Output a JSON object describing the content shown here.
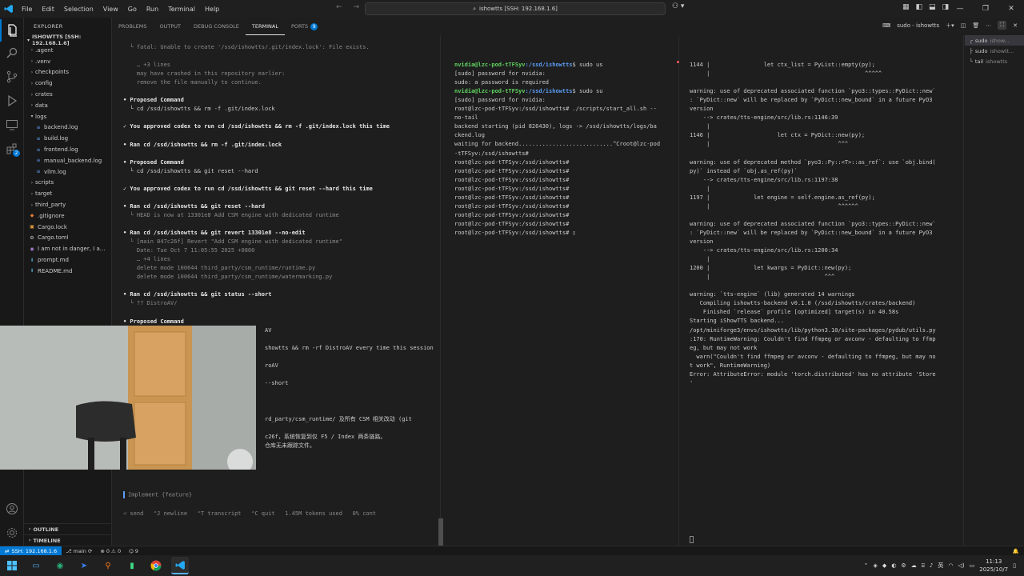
{
  "titlebar": {
    "menu": [
      "File",
      "Edit",
      "Selection",
      "View",
      "Go",
      "Run",
      "Terminal",
      "Help"
    ],
    "command_center": "ishowtts [SSH: 192.168.1.6]"
  },
  "sidebar": {
    "header": "EXPLORER",
    "root": "ISHOWTTS [SSH: 192.168.1.6]",
    "items": [
      {
        "label": ".agent",
        "type": "folder",
        "depth": 1,
        "expanded": false
      },
      {
        "label": ".venv",
        "type": "folder",
        "depth": 1,
        "expanded": false
      },
      {
        "label": "checkpoints",
        "type": "folder",
        "depth": 1,
        "expanded": false
      },
      {
        "label": "config",
        "type": "folder",
        "depth": 1,
        "expanded": false
      },
      {
        "label": "crates",
        "type": "folder",
        "depth": 1,
        "expanded": false
      },
      {
        "label": "data",
        "type": "folder",
        "depth": 1,
        "expanded": false
      },
      {
        "label": "logs",
        "type": "folder",
        "depth": 1,
        "expanded": true
      },
      {
        "label": "backend.log",
        "type": "log",
        "depth": 2
      },
      {
        "label": "build.log",
        "type": "log",
        "depth": 2
      },
      {
        "label": "frontend.log",
        "type": "log",
        "depth": 2
      },
      {
        "label": "manual_backend.log",
        "type": "log",
        "depth": 2
      },
      {
        "label": "vllm.log",
        "type": "log",
        "depth": 2
      },
      {
        "label": "scripts",
        "type": "folder",
        "depth": 1,
        "expanded": false
      },
      {
        "label": "target",
        "type": "folder",
        "depth": 1,
        "expanded": false
      },
      {
        "label": "third_party",
        "type": "folder",
        "depth": 1,
        "expanded": false
      },
      {
        "label": ".gitignore",
        "type": "git",
        "depth": 1
      },
      {
        "label": "Cargo.lock",
        "type": "lock",
        "depth": 1
      },
      {
        "label": "Cargo.toml",
        "type": "toml",
        "depth": 1
      },
      {
        "label": "I am not in danger, I a...",
        "type": "audio",
        "depth": 1
      },
      {
        "label": "prompt.md",
        "type": "md",
        "depth": 1
      },
      {
        "label": "README.md",
        "type": "md",
        "depth": 1
      }
    ],
    "outline": "OUTLINE",
    "timeline": "TIMELINE"
  },
  "panel": {
    "tabs": [
      {
        "label": "PROBLEMS",
        "active": false
      },
      {
        "label": "OUTPUT",
        "active": false
      },
      {
        "label": "DEBUG CONSOLE",
        "active": false
      },
      {
        "label": "TERMINAL",
        "active": true
      },
      {
        "label": "PORTS",
        "active": false,
        "badge": "9"
      }
    ],
    "session_label": "sudo - ishowtts"
  },
  "term1": {
    "lines": [
      {
        "cls": "dim",
        "text": "  └ fatal: Unable to create '/ssd/ishowtts/.git/index.lock': File exists."
      },
      {
        "cls": "dim",
        "text": ""
      },
      {
        "cls": "dim",
        "text": "    … +3 lines"
      },
      {
        "cls": "dim",
        "text": "    may have crashed in this repository earlier:"
      },
      {
        "cls": "dim",
        "text": "    remove the file manually to continue."
      },
      {
        "cls": "",
        "text": ""
      },
      {
        "cls": "bold",
        "text": "• Proposed Command"
      },
      {
        "cls": "",
        "text": "  └ cd /ssd/ishowtts && rm -f .git/index.lock"
      },
      {
        "cls": "",
        "text": ""
      },
      {
        "cls": "approve",
        "text": "✓ You approved codex to run cd /ssd/ishowtts && rm -f .git/index.lock this time"
      },
      {
        "cls": "",
        "text": ""
      },
      {
        "cls": "bold",
        "text": "• Ran cd /ssd/ishowtts && rm -f .git/index.lock"
      },
      {
        "cls": "",
        "text": ""
      },
      {
        "cls": "bold",
        "text": "• Proposed Command"
      },
      {
        "cls": "",
        "text": "  └ cd /ssd/ishowtts && git reset --hard"
      },
      {
        "cls": "",
        "text": ""
      },
      {
        "cls": "approve",
        "text": "✓ You approved codex to run cd /ssd/ishowtts && git reset --hard this time"
      },
      {
        "cls": "",
        "text": ""
      },
      {
        "cls": "bold",
        "text": "• Ran cd /ssd/ishowtts && git reset --hard"
      },
      {
        "cls": "dim",
        "text": "  └ HEAD is now at 13301e8 Add CSM engine with dedicated runtime"
      },
      {
        "cls": "",
        "text": ""
      },
      {
        "cls": "bold",
        "text": "• Ran cd /ssd/ishowtts && git revert 13301e8 --no-edit"
      },
      {
        "cls": "dim",
        "text": "  └ [main 847c26f] Revert \"Add CSM engine with dedicated runtime\""
      },
      {
        "cls": "dim",
        "text": "    Date: Tue Oct 7 11:05:55 2025 +0800"
      },
      {
        "cls": "dim",
        "text": "    … +4 lines"
      },
      {
        "cls": "dim",
        "text": "    delete mode 100644 third_party/csm_runtime/runtime.py"
      },
      {
        "cls": "dim",
        "text": "    delete mode 100644 third_party/csm_runtime/watermarking.py"
      },
      {
        "cls": "",
        "text": ""
      },
      {
        "cls": "bold",
        "text": "• Ran cd /ssd/ishowtts && git status --short"
      },
      {
        "cls": "dim",
        "text": "  └ ?? DistroAV/"
      },
      {
        "cls": "",
        "text": ""
      },
      {
        "cls": "bold",
        "text": "• Proposed Command"
      },
      {
        "cls": "",
        "text": "                                          AV"
      },
      {
        "cls": "",
        "text": ""
      },
      {
        "cls": "",
        "text": "                                          showtts && rm -rf DistroAV every time this session"
      },
      {
        "cls": "",
        "text": ""
      },
      {
        "cls": "",
        "text": "                                          roAV"
      },
      {
        "cls": "",
        "text": ""
      },
      {
        "cls": "",
        "text": "                                          --short"
      },
      {
        "cls": "",
        "text": ""
      },
      {
        "cls": "",
        "text": ""
      },
      {
        "cls": "",
        "text": ""
      },
      {
        "cls": "",
        "text": "                                          rd_party/csm_runtime/ 及所有 CSM 相关改动 (git"
      },
      {
        "cls": "",
        "text": ""
      },
      {
        "cls": "",
        "text": "                                          c26f，系统恢复到仅 F5 / Index 两条链路。"
      },
      {
        "cls": "",
        "text": "                                          仓库无未跟踪文件。"
      }
    ],
    "input_placeholder": "Implement {feature}",
    "footer": "⏎ send   ⌃J newline   ⌃T transcript   ⌃C quit   1.45M tokens used   0% cont"
  },
  "term2": {
    "lines": [
      {
        "type": "prompt",
        "user": "nvidia@lzc-pod-tTFSyv",
        "path": ":/ssd/ishowtts",
        "cmd": "$ sudo us"
      },
      {
        "type": "text",
        "text": "[sudo] password for nvidia:"
      },
      {
        "type": "text",
        "text": "sudo: a password is required"
      },
      {
        "type": "prompt",
        "user": "nvidia@lzc-pod-tTFSyv",
        "path": ":/ssd/ishowtts",
        "cmd": "$ sudo su"
      },
      {
        "type": "text",
        "text": "[sudo] password for nvidia:"
      },
      {
        "type": "text",
        "text": "root@lzc-pod-tTFSyv:/ssd/ishowtts# ./scripts/start_all.sh --"
      },
      {
        "type": "text",
        "text": "no-tail"
      },
      {
        "type": "text",
        "text": "backend starting (pid 826430), logs -> /ssd/ishowtts/logs/ba"
      },
      {
        "type": "text",
        "text": "ckend.log"
      },
      {
        "type": "text",
        "text": "waiting for backend............................^Croot@lzc-pod"
      },
      {
        "type": "text",
        "text": "-tTFSyv:/ssd/ishowtts#"
      },
      {
        "type": "text",
        "text": "root@lzc-pod-tTFSyv:/ssd/ishowtts#"
      },
      {
        "type": "text",
        "text": "root@lzc-pod-tTFSyv:/ssd/ishowtts#"
      },
      {
        "type": "text",
        "text": "root@lzc-pod-tTFSyv:/ssd/ishowtts#"
      },
      {
        "type": "text",
        "text": "root@lzc-pod-tTFSyv:/ssd/ishowtts#"
      },
      {
        "type": "text",
        "text": "root@lzc-pod-tTFSyv:/ssd/ishowtts#"
      },
      {
        "type": "text",
        "text": "root@lzc-pod-tTFSyv:/ssd/ishowtts#"
      },
      {
        "type": "text",
        "text": "root@lzc-pod-tTFSyv:/ssd/ishowtts#"
      },
      {
        "type": "text",
        "text": "root@lzc-pod-tTFSyv:/ssd/ishowtts#"
      },
      {
        "type": "text",
        "text": "root@lzc-pod-tTFSyv:/ssd/ishowtts# ▯"
      }
    ]
  },
  "term3": {
    "lines": [
      "1144 |                let ctx_list = PyList::empty(py);",
      "     |                                              ^^^^^",
      "",
      "warning: use of deprecated associated function `pyo3::types::PyDict::new`",
      ": `PyDict::new` will be replaced by `PyDict::new_bound` in a future PyO3",
      "version",
      "    --> crates/tts-engine/src/lib.rs:1146:39",
      "     |",
      "1146 |                    let ctx = PyDict::new(py);",
      "     |                                      ^^^",
      "",
      "warning: use of deprecated method `pyo3::Py::<T>::as_ref`: use `obj.bind(",
      "py)` instead of `obj.as_ref(py)`",
      "    --> crates/tts-engine/src/lib.rs:1197:38",
      "     |",
      "1197 |             let engine = self.engine.as_ref(py);",
      "     |                                      ^^^^^^",
      "",
      "warning: use of deprecated associated function `pyo3::types::PyDict::new`",
      ": `PyDict::new` will be replaced by `PyDict::new_bound` in a future PyO3",
      "version",
      "    --> crates/tts-engine/src/lib.rs:1200:34",
      "     |",
      "1200 |             let kwargs = PyDict::new(py);",
      "     |                                  ^^^",
      "",
      "warning: `tts-engine` (lib) generated 14 warnings",
      "   Compiling ishowtts-backend v0.1.0 (/ssd/ishowtts/crates/backend)",
      "    Finished `release` profile [optimized] target(s) in 40.58s",
      "Starting iShowTTS backend...",
      "/opt/miniforge3/envs/ishowtts/lib/python3.10/site-packages/pydub/utils.py",
      ":170: RuntimeWarning: Couldn't find ffmpeg or avconv - defaulting to ffmp",
      "eg, but may not work",
      "  warn(\"Couldn't find ffmpeg or avconv - defaulting to ffmpeg, but may no",
      "t work\", RuntimeWarning)",
      "Error: AttributeError: module 'torch.distributed' has no attribute 'Store",
      "'"
    ]
  },
  "termlist": [
    {
      "name": "sudo",
      "sub": "ishow...",
      "selected": true
    },
    {
      "name": "sudo",
      "sub": "ishowtt...",
      "selected": false
    },
    {
      "name": "tail",
      "sub": "ishowtts",
      "selected": false
    }
  ],
  "statusbar": {
    "remote": "SSH: 192.168.1.6",
    "branch": "main",
    "problems": "⊗ 0 ⚠ 0",
    "ports": "9"
  },
  "taskbar": {
    "tray_lang": "英",
    "time": "11:13",
    "date": "2025/10/7"
  },
  "colors": {
    "accent": "#0078d4",
    "green_prompt": "#5fd35f",
    "blue_path": "#5c9cf5"
  }
}
